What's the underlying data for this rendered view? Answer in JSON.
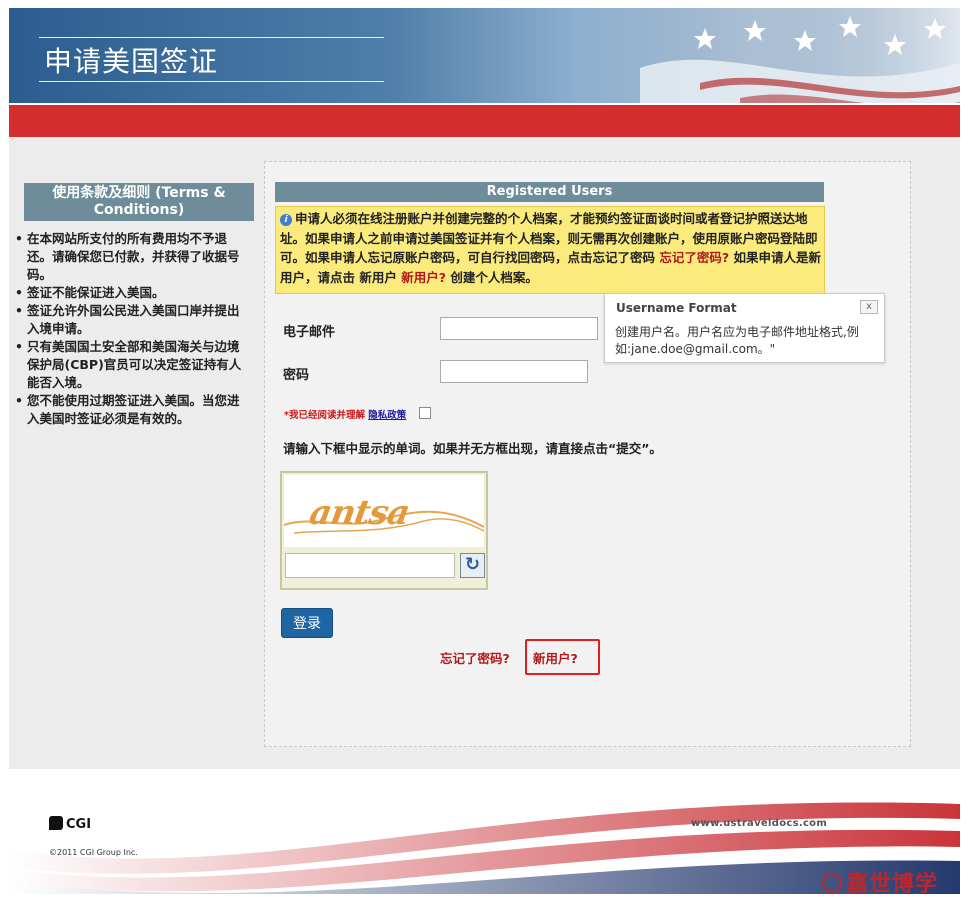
{
  "header": {
    "title": "申请美国签证"
  },
  "terms": {
    "heading": "使用条款及细则 (Terms & Conditions)",
    "items": [
      "在本网站所支付的所有费用均不予退还。请确保您已付款，并获得了收据号码。",
      "签证不能保证进入美国。",
      "签证允许外国公民进入美国口岸并提出入境申请。",
      "只有美国国土安全部和美国海关与边境保护局(CBP)官员可以决定签证持有人能否入境。",
      "您不能使用过期签证进入美国。当您进入美国时签证必须是有效的。"
    ]
  },
  "login": {
    "heading": "Registered Users",
    "notice_part1": "申请人必须在线注册账户并创建完整的个人档案，才能预约签证面谈时间或者登记护照送达地址。如果申请人之前申请过美国签证并有个人档案，则无需再次创建账户，使用原账户密码登陆即可。如果申请人忘记原账户密码，可自行找回密码，点击忘记了密码",
    "notice_link1": "忘记了密码?",
    "notice_part2": "如果申请人是新用户，请点击 新用户",
    "notice_link2": "新用户?",
    "notice_part3": "创建个人档案。",
    "email_label": "电子邮件",
    "password_label": "密码",
    "agree_text": "*我已经阅读并理解",
    "privacy_link": "隐私政策",
    "captcha_instruction": "请输入下框中显示的单词。如果并无方框出现，请直接点击“提交”。",
    "captcha_word": "antsa",
    "login_button": "登录",
    "forgot_link": "忘记了密码?",
    "new_user_link": "新用户?"
  },
  "tooltip": {
    "title": "Username Format",
    "close": "x",
    "body": "创建用户名。用户名应为电子邮件地址格式,例如:jane.doe@gmail.com。\""
  },
  "footer": {
    "brand": "CGI",
    "copyright": "©2011 CGI Group Inc.",
    "site": "www.ustraveldocs.com",
    "watermark": "嘉世博学"
  }
}
